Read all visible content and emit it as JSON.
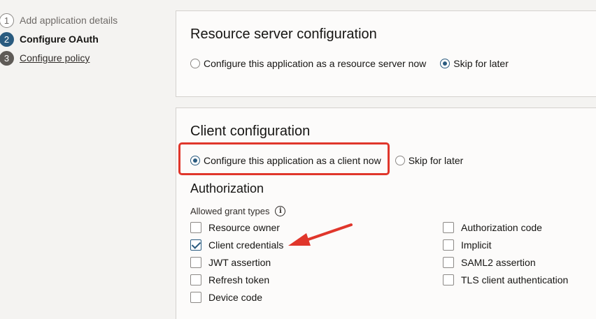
{
  "steps": [
    {
      "num": "1",
      "label": "Add application details",
      "state": "done"
    },
    {
      "num": "2",
      "label": "Configure OAuth",
      "state": "active"
    },
    {
      "num": "3",
      "label": "Configure policy",
      "state": "todo"
    }
  ],
  "resource_server": {
    "title": "Resource server configuration",
    "options": [
      {
        "label": "Configure this application as a resource server now",
        "selected": false
      },
      {
        "label": "Skip for later",
        "selected": true
      }
    ]
  },
  "client": {
    "title": "Client configuration",
    "options": [
      {
        "label": "Configure this application as a client now",
        "selected": true
      },
      {
        "label": "Skip for later",
        "selected": false
      }
    ],
    "authorization": {
      "title": "Authorization",
      "grant_label": "Allowed grant types",
      "info_icon": "i",
      "grants_left": [
        {
          "label": "Resource owner",
          "checked": false
        },
        {
          "label": "Client credentials",
          "checked": true
        },
        {
          "label": "JWT assertion",
          "checked": false
        },
        {
          "label": "Refresh token",
          "checked": false
        },
        {
          "label": "Device code",
          "checked": false
        }
      ],
      "grants_right": [
        {
          "label": "Authorization code",
          "checked": false
        },
        {
          "label": "Implicit",
          "checked": false
        },
        {
          "label": "SAML2 assertion",
          "checked": false
        },
        {
          "label": "TLS client authentication",
          "checked": false
        }
      ]
    }
  },
  "colors": {
    "accent": "#2a5b7f",
    "highlight": "#e0362b"
  }
}
